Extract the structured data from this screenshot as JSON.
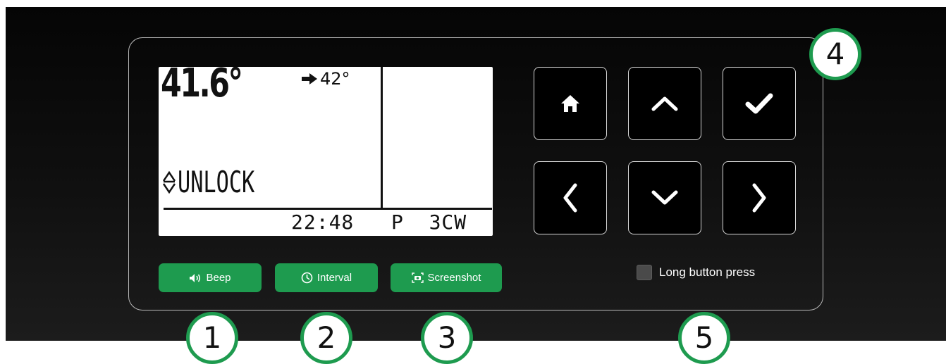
{
  "display": {
    "temperature": "41.6°",
    "target": "42°",
    "lock_status": "UNLOCK",
    "time": "22:48",
    "mode": "P  3CW"
  },
  "keypad": {
    "home_icon": "home-icon",
    "up_icon": "chevron-up-icon",
    "ok_icon": "check-icon",
    "left_icon": "chevron-left-icon",
    "down_icon": "chevron-down-icon",
    "right_icon": "chevron-right-icon"
  },
  "actions": {
    "beep_label": "Beep",
    "interval_label": "Interval",
    "screenshot_label": "Screenshot"
  },
  "options": {
    "long_press_label": "Long button press",
    "long_press_checked": false
  },
  "callouts": [
    "1",
    "2",
    "3",
    "4",
    "5"
  ],
  "colors": {
    "accent": "#1e9b4f",
    "background": "#0a0a0a",
    "key_background": "#000000"
  }
}
